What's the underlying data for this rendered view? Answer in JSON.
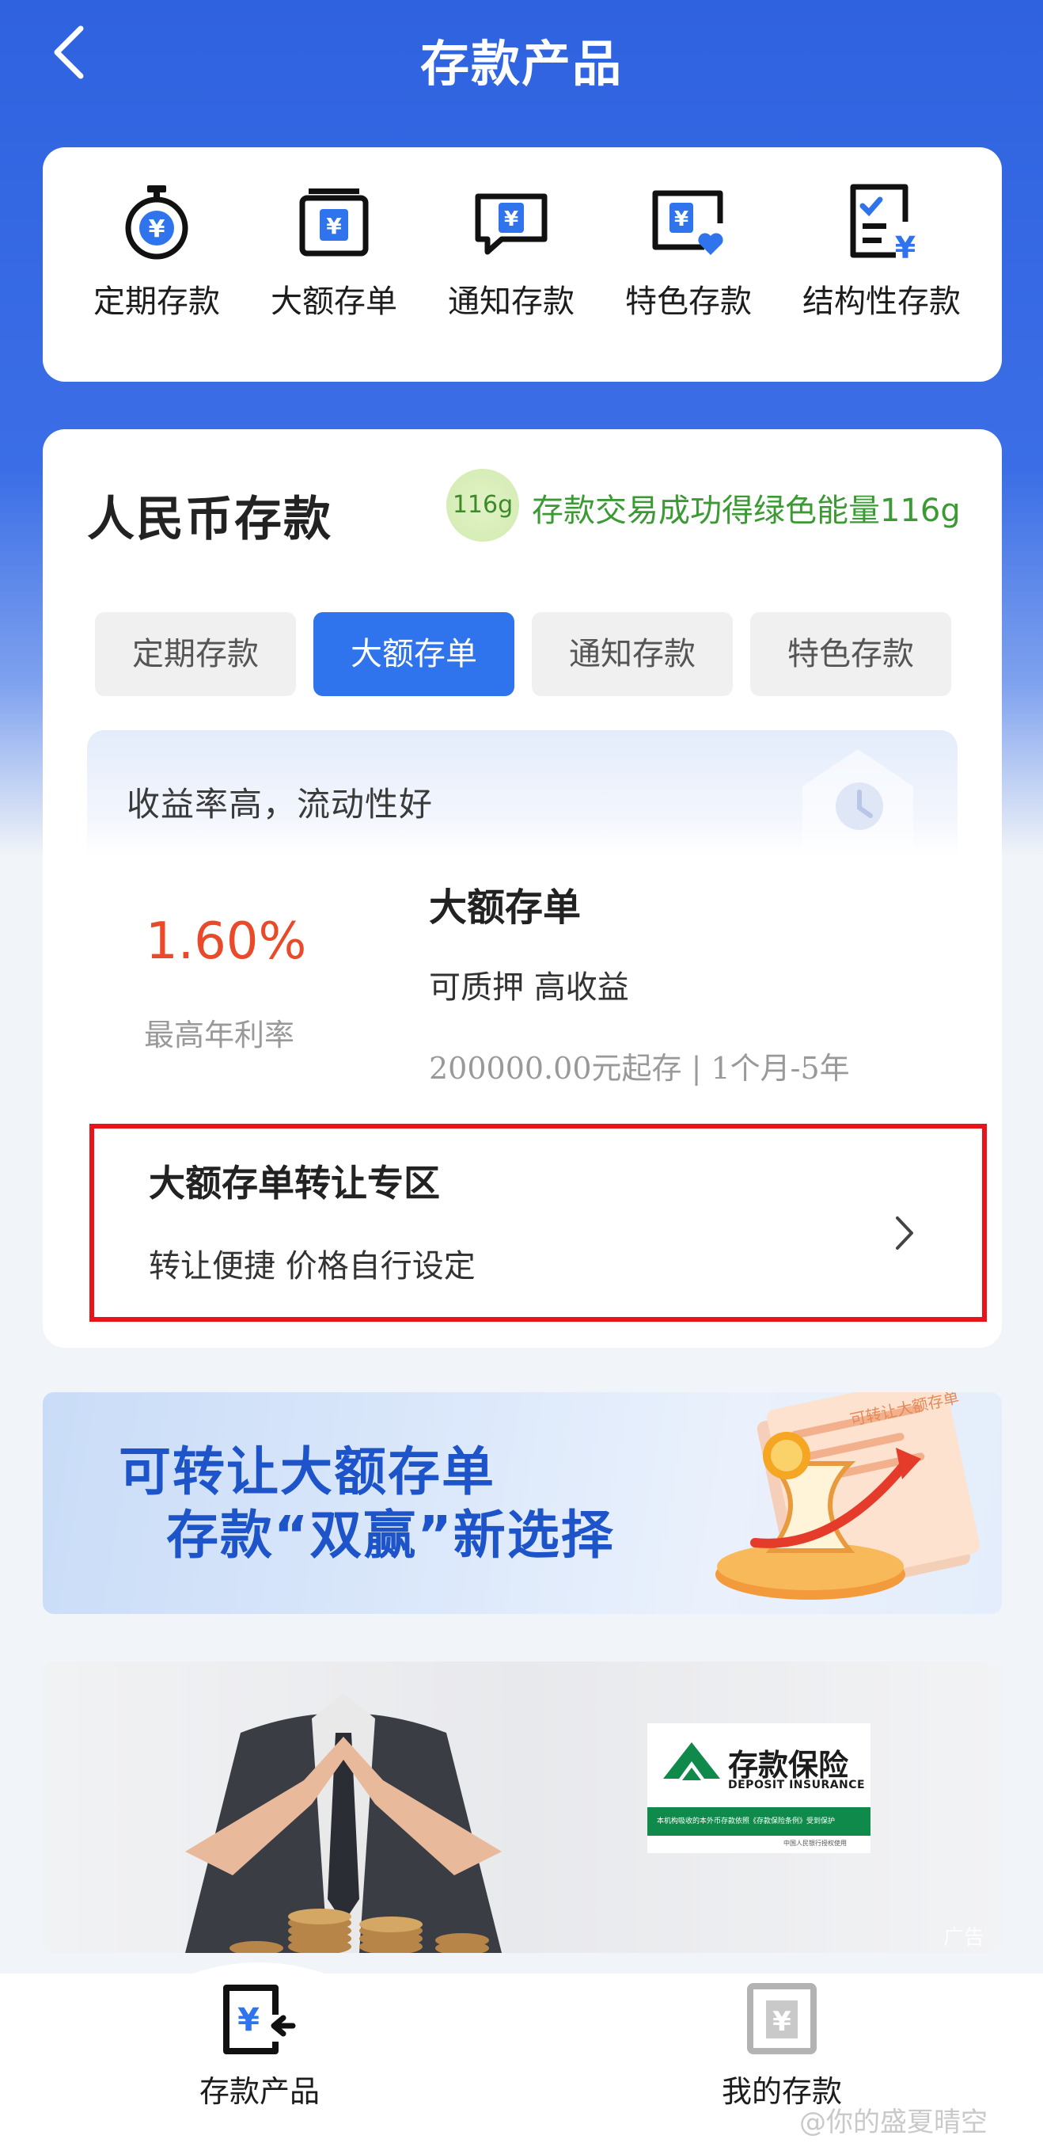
{
  "header": {
    "title": "存款产品"
  },
  "categories": [
    {
      "label": "定期存款",
      "icon": "timer-yuan-icon"
    },
    {
      "label": "大额存单",
      "icon": "certificate-yuan-icon"
    },
    {
      "label": "通知存款",
      "icon": "message-yuan-icon"
    },
    {
      "label": "特色存款",
      "icon": "card-heart-yuan-icon"
    },
    {
      "label": "结构性存款",
      "icon": "checklist-yuan-icon"
    }
  ],
  "section": {
    "title": "人民币存款",
    "energy_badge": "116g",
    "energy_text": "存款交易成功得绿色能量116g"
  },
  "tabs": [
    {
      "label": "定期存款",
      "active": false
    },
    {
      "label": "大额存单",
      "active": true
    },
    {
      "label": "通知存款",
      "active": false
    },
    {
      "label": "特色存款",
      "active": false
    }
  ],
  "promo": {
    "text": "收益率高，流动性好"
  },
  "product": {
    "rate": "1.60%",
    "rate_label": "最高年利率",
    "name": "大额存单",
    "features": "可质押  高收益",
    "meta": "200000.00元起存 | 1个月-5年"
  },
  "transfer": {
    "title": "大额存单转让专区",
    "subtitle": "转让便捷  价格自行设定"
  },
  "ad_banner": {
    "line1": "可转让大额存单",
    "line2": "存款“双赢”新选择",
    "doc_label": "可转让大额存单"
  },
  "insurance_ad": {
    "title": "存款保险",
    "subtitle": "DEPOSIT INSURANCE",
    "green_text": "本机构吸收的本外币存款依照《存款保险条例》受到保护",
    "foot": "中国人民银行授权使用",
    "ad_tag": "广告"
  },
  "bottom_nav": [
    {
      "label": "存款产品",
      "active": true
    },
    {
      "label": "我的存款",
      "active": false
    }
  ],
  "watermark": "@你的盛夏晴空",
  "colors": {
    "primary": "#2f74ec",
    "header_bg": "#2f62df",
    "rate": "#e84a2a",
    "energy": "#3c9a34",
    "highlight_border": "#e8141a",
    "insurance_green": "#0f8a4a"
  }
}
